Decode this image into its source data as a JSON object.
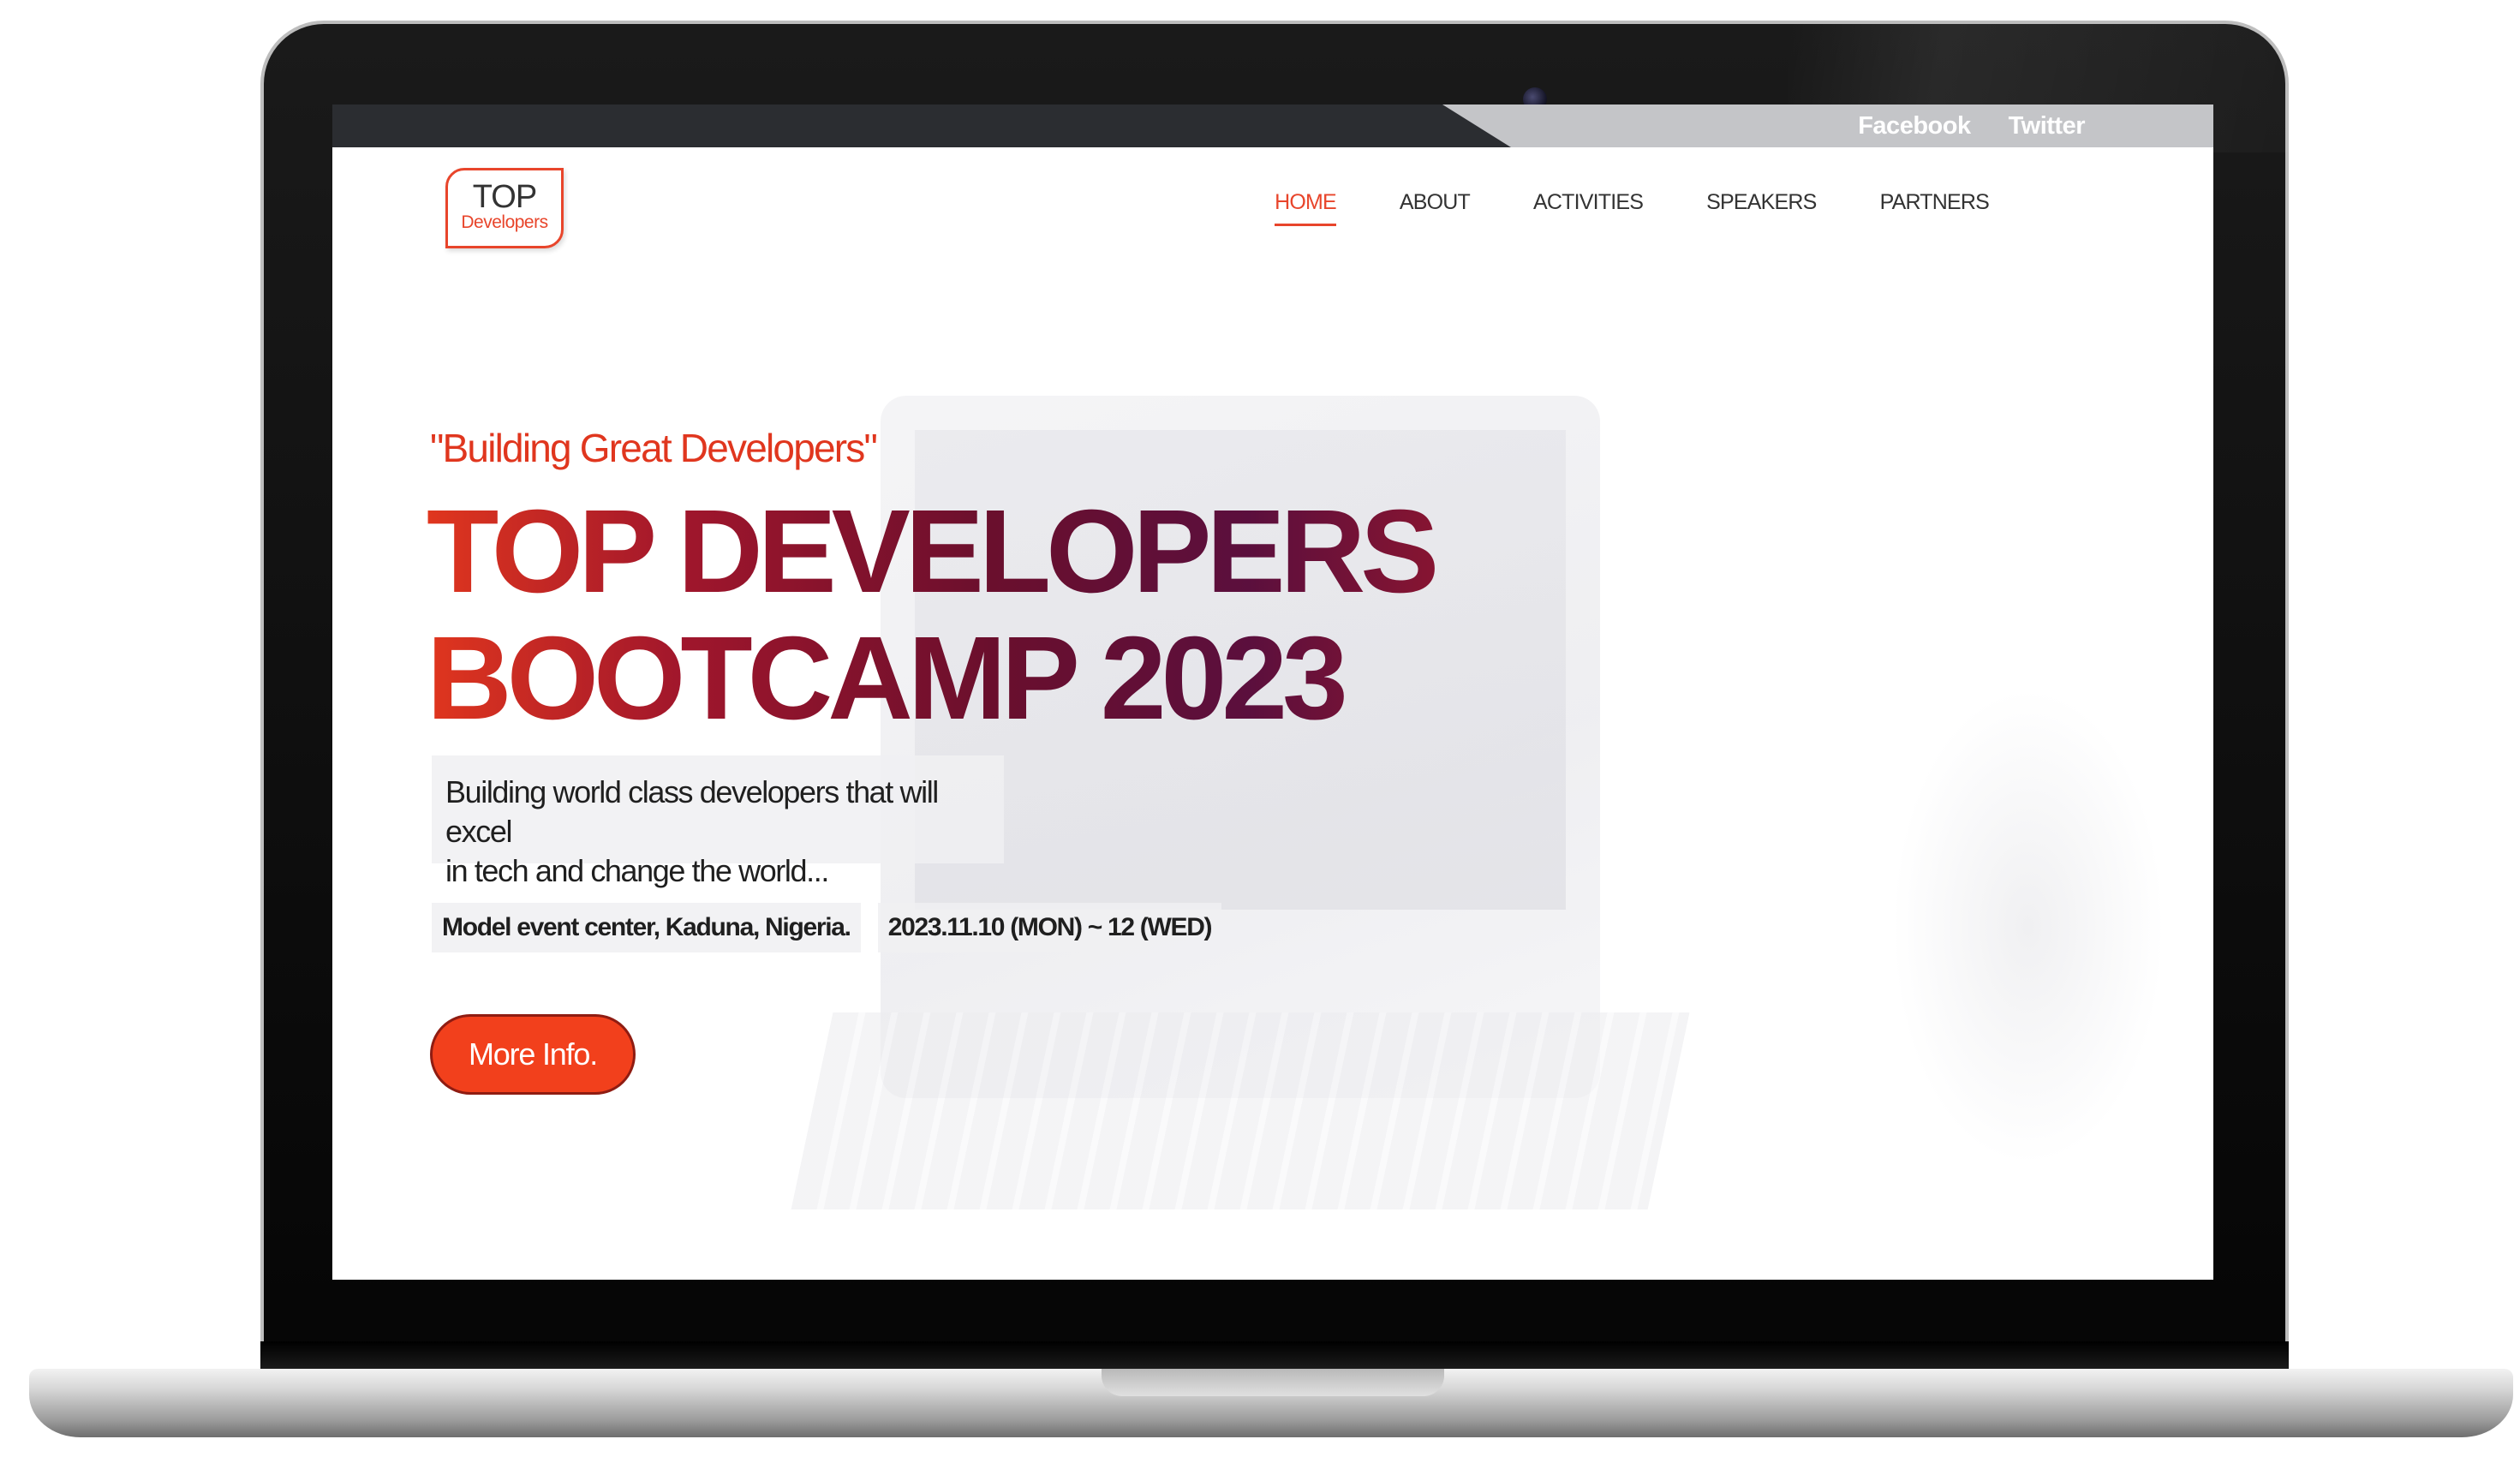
{
  "topbar": {
    "social": [
      {
        "label": "Facebook"
      },
      {
        "label": "Twitter"
      }
    ]
  },
  "logo": {
    "top": "TOP",
    "sub": "Developers"
  },
  "nav": {
    "items": [
      {
        "label": "HOME",
        "active": true
      },
      {
        "label": "ABOUT",
        "active": false
      },
      {
        "label": "ACTIVITIES",
        "active": false
      },
      {
        "label": "SPEAKERS",
        "active": false
      },
      {
        "label": "PARTNERS",
        "active": false
      }
    ]
  },
  "hero": {
    "tagline": "\"Building Great Developers\"",
    "title_line1": "TOP DEVELOPERS",
    "title_line2": "BOOTCAMP 2023",
    "description_line1": "Building world class developers that will excel",
    "description_line2": "in tech and change the world...",
    "location": "Model event center, Kaduna, Nigeria.",
    "dates": "2023.11.10 (MON) ~ 12 (WED)",
    "cta_label": "More Info."
  },
  "colors": {
    "accent": "#e8452b",
    "button": "#f2401c",
    "topbar": "#2b2d31"
  }
}
